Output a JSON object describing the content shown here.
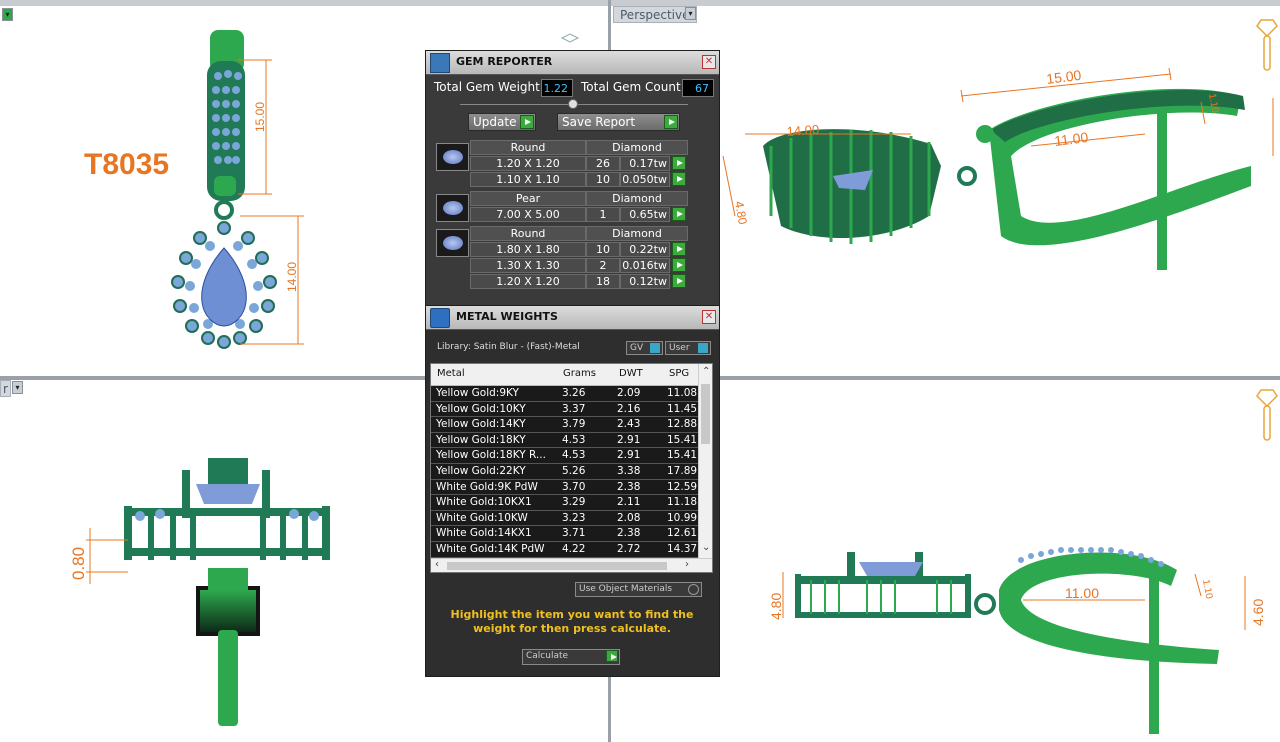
{
  "viewports": {
    "top_left": {
      "label": ""
    },
    "top_right": {
      "label": "Perspective"
    },
    "bottom_left": {
      "label": "r"
    },
    "bottom_right": {
      "label": ""
    }
  },
  "annotations": {
    "model_code": "T8035",
    "dims": {
      "tl_15": "15.00",
      "tl_14": "14.00",
      "tr_15": "15.00",
      "tr_14": "14.00",
      "tr_11": "11.00",
      "tr_480": "4.80",
      "tr_110": "1.10",
      "bl_080": "0.80",
      "br_480": "4.80",
      "br_11": "11.00",
      "br_460": "4.60",
      "br_110": "1.10"
    }
  },
  "gem_reporter": {
    "title": "GEM REPORTER",
    "total_weight_label": "Total Gem Weight",
    "total_weight_value": "1.22",
    "total_count_label": "Total Gem Count",
    "total_count_value": "67",
    "update_label": "Update",
    "save_label": "Save Report",
    "groups": [
      {
        "shape": "Round",
        "material": "Diamond",
        "rows": [
          {
            "size": "1.20 X 1.20",
            "count": "26",
            "weight": "0.17tw"
          },
          {
            "size": "1.10 X 1.10",
            "count": "10",
            "weight": "0.050tw"
          }
        ]
      },
      {
        "shape": "Pear",
        "material": "Diamond",
        "rows": [
          {
            "size": "7.00 X 5.00",
            "count": "1",
            "weight": "0.65tw"
          }
        ]
      },
      {
        "shape": "Round",
        "material": "Diamond",
        "rows": [
          {
            "size": "1.80 X 1.80",
            "count": "10",
            "weight": "0.22tw"
          },
          {
            "size": "1.30 X 1.30",
            "count": "2",
            "weight": "0.016tw"
          },
          {
            "size": "1.20 X 1.20",
            "count": "18",
            "weight": "0.12tw"
          }
        ]
      }
    ]
  },
  "metal_weights": {
    "title": "METAL WEIGHTS",
    "library": "Library: Satin Blur - (Fast)-Metal",
    "gv_label": "GV",
    "user_label": "User",
    "columns": [
      "Metal",
      "Grams",
      "DWT",
      "SPG"
    ],
    "rows": [
      [
        "Yellow Gold:9KY",
        "3.26",
        "2.09",
        "11.08"
      ],
      [
        "Yellow Gold:10KY",
        "3.37",
        "2.16",
        "11.45"
      ],
      [
        "Yellow Gold:14KY",
        "3.79",
        "2.43",
        "12.88"
      ],
      [
        "Yellow Gold:18KY",
        "4.53",
        "2.91",
        "15.41"
      ],
      [
        "Yellow Gold:18KY R...",
        "4.53",
        "2.91",
        "15.41"
      ],
      [
        "Yellow Gold:22KY",
        "5.26",
        "3.38",
        "17.89"
      ],
      [
        "White Gold:9K PdW",
        "3.70",
        "2.38",
        "12.59"
      ],
      [
        "White Gold:10KX1",
        "3.29",
        "2.11",
        "11.18"
      ],
      [
        "White Gold:10KW",
        "3.23",
        "2.08",
        "10.99"
      ],
      [
        "White Gold:14KX1",
        "3.71",
        "2.38",
        "12.61"
      ],
      [
        "White Gold:14K PdW",
        "4.22",
        "2.72",
        "14.37"
      ]
    ],
    "use_object_materials": "Use Object Materials",
    "hint": "Highlight the item you want to find the weight for then press calculate.",
    "calculate_label": "Calculate"
  }
}
